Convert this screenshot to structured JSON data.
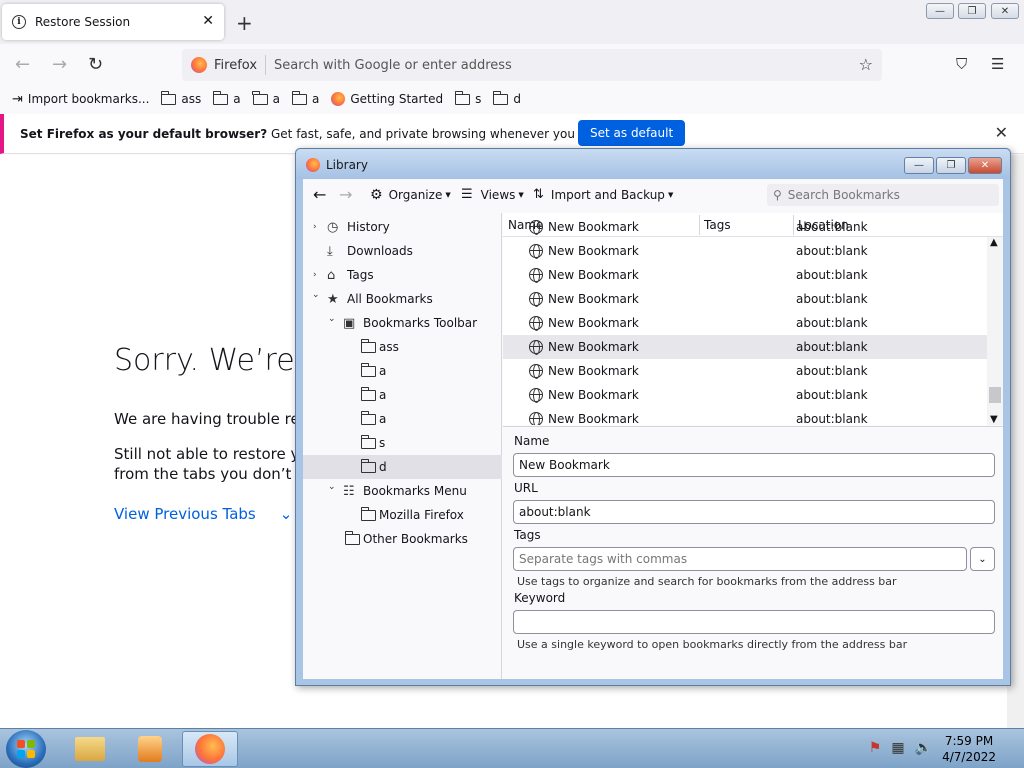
{
  "tab": {
    "title": "Restore Session",
    "close": "✕",
    "new_tab": "+"
  },
  "window_controls": {
    "minimize": "—",
    "maximize": "❐",
    "close": "✕"
  },
  "nav": {
    "back": "←",
    "forward": "→",
    "reload": "↻",
    "identity": "Firefox",
    "placeholder": "Search with Google or enter address",
    "star": "☆",
    "pocket": "⛉",
    "menu": "☰"
  },
  "bookmarks_bar": [
    {
      "label": "Import bookmarks...",
      "icon": "import-icon"
    },
    {
      "label": "ass",
      "icon": "folder-icon"
    },
    {
      "label": "a",
      "icon": "folder-icon"
    },
    {
      "label": "a",
      "icon": "folder-icon"
    },
    {
      "label": "a",
      "icon": "folder-icon"
    },
    {
      "label": "Getting Started",
      "icon": "firefox-icon"
    },
    {
      "label": "s",
      "icon": "folder-icon"
    },
    {
      "label": "d",
      "icon": "folder-icon"
    }
  ],
  "notification": {
    "bold": "Set Firefox as your default browser?",
    "text": " Get fast, safe, and private browsing whenever you use the web.",
    "button": "Set as default",
    "close": "✕"
  },
  "content": {
    "title": "Sorry. We’re h",
    "p1": "We are having trouble resto",
    "p2a": "Still not able to restore you",
    "p2b": "from the tabs you don’t nee",
    "link": "View Previous Tabs"
  },
  "library": {
    "title": "Library",
    "toolbar": {
      "organize": "Organize",
      "views": "Views",
      "import_backup": "Import and Backup",
      "search_placeholder": "Search Bookmarks"
    },
    "tree": [
      {
        "label": "History",
        "twisty": "›",
        "icon": "history-icon"
      },
      {
        "label": "Downloads",
        "twisty": "",
        "icon": "download-icon"
      },
      {
        "label": "Tags",
        "twisty": "›",
        "icon": "tag-icon"
      },
      {
        "label": "All Bookmarks",
        "twisty": "⌄",
        "icon": "star-icon"
      },
      {
        "label": "Bookmarks Toolbar",
        "twisty": "⌄",
        "icon": "toolbar-icon"
      },
      {
        "label": "ass",
        "twisty": "",
        "icon": "folder-icon"
      },
      {
        "label": "a",
        "twisty": "",
        "icon": "folder-icon"
      },
      {
        "label": "a",
        "twisty": "",
        "icon": "folder-icon"
      },
      {
        "label": "a",
        "twisty": "",
        "icon": "folder-icon"
      },
      {
        "label": "s",
        "twisty": "",
        "icon": "folder-icon"
      },
      {
        "label": "d",
        "twisty": "",
        "icon": "folder-icon"
      },
      {
        "label": "Bookmarks Menu",
        "twisty": "⌄",
        "icon": "menu-icon"
      },
      {
        "label": "Mozilla Firefox",
        "twisty": "",
        "icon": "folder-icon"
      },
      {
        "label": "Other Bookmarks",
        "twisty": "",
        "icon": "folder-icon"
      }
    ],
    "columns": {
      "name": "Name",
      "tags": "Tags",
      "location": "Location"
    },
    "rows": [
      {
        "name": "New Bookmark",
        "location": "about:blank"
      },
      {
        "name": "New Bookmark",
        "location": "about:blank"
      },
      {
        "name": "New Bookmark",
        "location": "about:blank"
      },
      {
        "name": "New Bookmark",
        "location": "about:blank"
      },
      {
        "name": "New Bookmark",
        "location": "about:blank"
      },
      {
        "name": "New Bookmark",
        "location": "about:blank"
      },
      {
        "name": "New Bookmark",
        "location": "about:blank"
      },
      {
        "name": "New Bookmark",
        "location": "about:blank"
      },
      {
        "name": "New Bookmark",
        "location": "about:blank"
      }
    ],
    "details": {
      "name_label": "Name",
      "name_value": "New Bookmark",
      "url_label": "URL",
      "url_value": "about:blank",
      "tags_label": "Tags",
      "tags_placeholder": "Separate tags with commas",
      "tags_hint": "Use tags to organize and search for bookmarks from the address bar",
      "keyword_label": "Keyword",
      "keyword_value": "",
      "keyword_hint": "Use a single keyword to open bookmarks directly from the address bar"
    }
  },
  "taskbar": {
    "time": "7:59 PM",
    "date": "4/7/2022"
  },
  "colors": {
    "accent": "#0061e0",
    "notify_bar": "#e31587"
  }
}
